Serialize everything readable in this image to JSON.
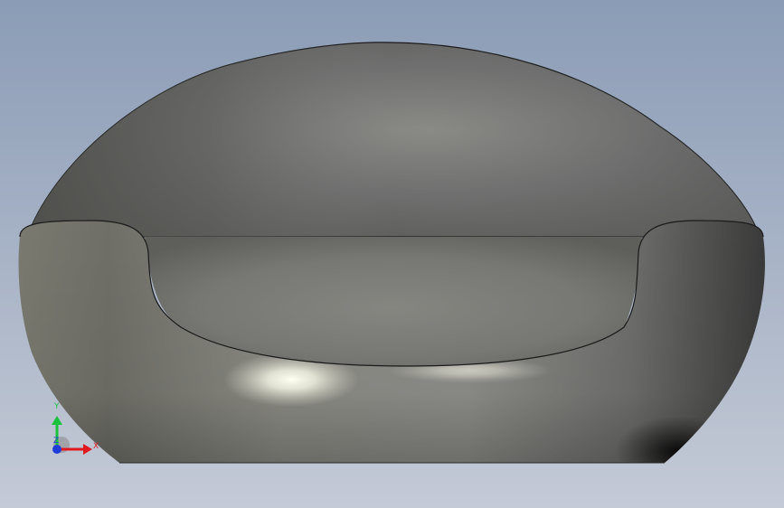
{
  "viewport": {
    "background_top_color": "#8b9cb6",
    "background_bottom_color": "#c4cad6",
    "model_base_color": "#7c7c78",
    "model_edge_color": "#1a1a1a",
    "highlight_color": "#fffff2"
  },
  "triad": {
    "x_label": "X",
    "y_label": "Y",
    "z_label": "Z",
    "x_color": "#e0191e",
    "y_color": "#18c23a",
    "z_color": "#1f3bd8"
  }
}
